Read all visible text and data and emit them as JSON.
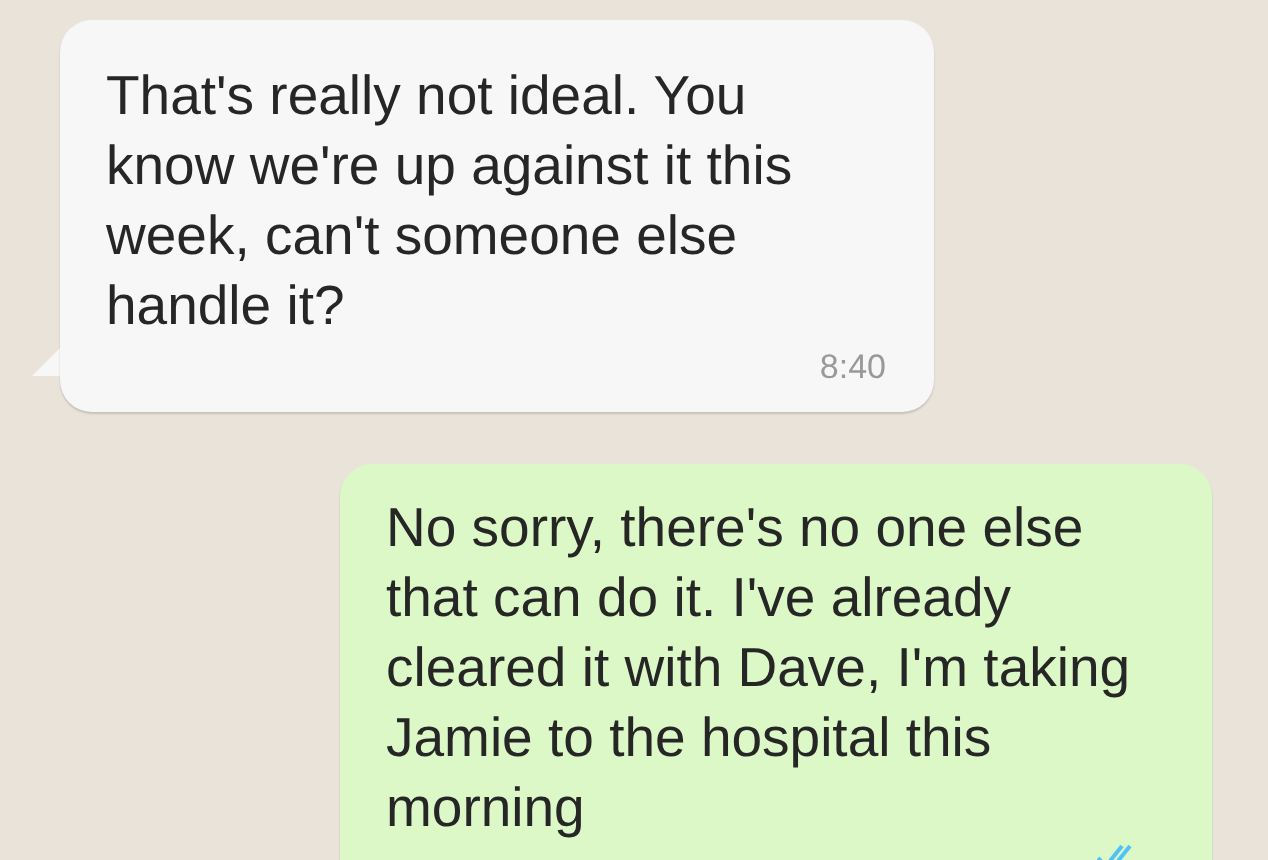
{
  "messages": [
    {
      "kind": "incoming",
      "text": "That's really not ideal. You know we're up against it this week, can't someone else handle it?",
      "time": "8:40"
    },
    {
      "kind": "outgoing",
      "text": "No sorry, there's no one else that can do it. I've already cleared it with Dave, I'm taking Jamie to the hospital this morning",
      "read": true
    }
  ]
}
